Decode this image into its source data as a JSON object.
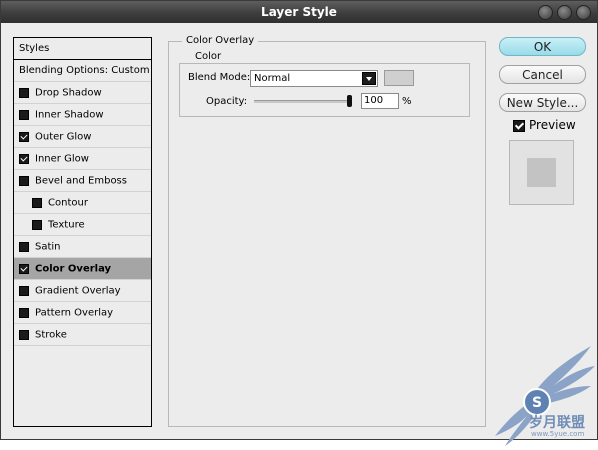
{
  "window": {
    "title": "Layer Style"
  },
  "styles_list": {
    "items": [
      {
        "label": "Styles",
        "checkbox": false,
        "checked": false,
        "selected": false,
        "indent": false,
        "kind": "header"
      },
      {
        "label": "Blending Options: Custom",
        "checkbox": false,
        "checked": false,
        "selected": false,
        "indent": false,
        "kind": "header2"
      },
      {
        "label": "Drop Shadow",
        "checkbox": true,
        "checked": false,
        "selected": false,
        "indent": false
      },
      {
        "label": "Inner Shadow",
        "checkbox": true,
        "checked": false,
        "selected": false,
        "indent": false
      },
      {
        "label": "Outer Glow",
        "checkbox": true,
        "checked": true,
        "selected": false,
        "indent": false
      },
      {
        "label": "Inner Glow",
        "checkbox": true,
        "checked": true,
        "selected": false,
        "indent": false
      },
      {
        "label": "Bevel and Emboss",
        "checkbox": true,
        "checked": false,
        "selected": false,
        "indent": false
      },
      {
        "label": "Contour",
        "checkbox": true,
        "checked": false,
        "selected": false,
        "indent": true
      },
      {
        "label": "Texture",
        "checkbox": true,
        "checked": false,
        "selected": false,
        "indent": true
      },
      {
        "label": "Satin",
        "checkbox": true,
        "checked": false,
        "selected": false,
        "indent": false
      },
      {
        "label": "Color Overlay",
        "checkbox": true,
        "checked": true,
        "selected": true,
        "indent": false
      },
      {
        "label": "Gradient Overlay",
        "checkbox": true,
        "checked": false,
        "selected": false,
        "indent": false
      },
      {
        "label": "Pattern Overlay",
        "checkbox": true,
        "checked": false,
        "selected": false,
        "indent": false
      },
      {
        "label": "Stroke",
        "checkbox": true,
        "checked": false,
        "selected": false,
        "indent": false
      }
    ]
  },
  "panel": {
    "title": "Color Overlay",
    "group_title": "Color",
    "blend_mode_label": "Blend Mode:",
    "blend_mode_value": "Normal",
    "overlay_color": "#cfcfcf",
    "opacity_label": "Opacity:",
    "opacity_value": "100",
    "opacity_fraction": 1.0,
    "opacity_unit": "%"
  },
  "buttons": {
    "ok": "OK",
    "cancel": "Cancel",
    "new_style": "New Style..."
  },
  "preview": {
    "label": "Preview",
    "checked": true
  },
  "watermark": {
    "text": "岁月联盟",
    "url": "www.5yue.com"
  },
  "colors": {
    "accent_ok": "#98dbe8",
    "selected_row": "#a5a5a5",
    "titlebar": "#3e3e3e",
    "watermark": "#6f8db6"
  }
}
